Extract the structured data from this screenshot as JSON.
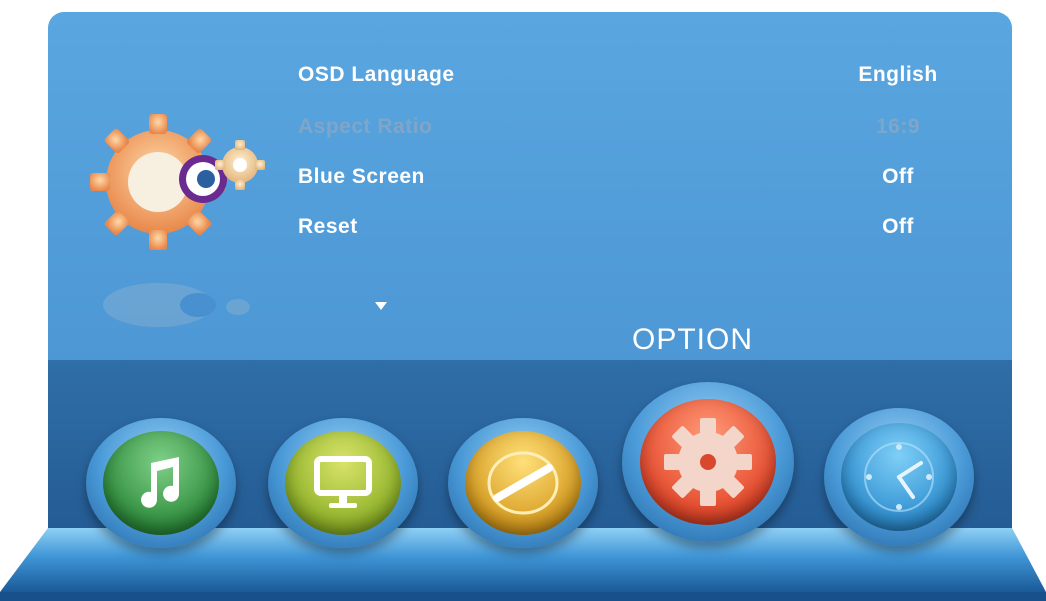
{
  "menu": {
    "items": [
      {
        "label": "OSD Language",
        "value": "English",
        "enabled": true
      },
      {
        "label": "Aspect Ratio",
        "value": "16:9",
        "enabled": false
      },
      {
        "label": "Blue Screen",
        "value": "Off",
        "enabled": true
      },
      {
        "label": "Reset",
        "value": "Off",
        "enabled": true
      }
    ]
  },
  "dock": {
    "active_title": "OPTION",
    "buttons": [
      {
        "icon": "music-note-icon"
      },
      {
        "icon": "monitor-icon"
      },
      {
        "icon": "dial-icon"
      },
      {
        "icon": "gear-icon"
      },
      {
        "icon": "clock-icon"
      }
    ]
  },
  "colors": {
    "panel": "#5aa6e0",
    "dock": "#2f6ea8",
    "disabled_text": "#7fa6c8",
    "text": "#ffffff"
  }
}
